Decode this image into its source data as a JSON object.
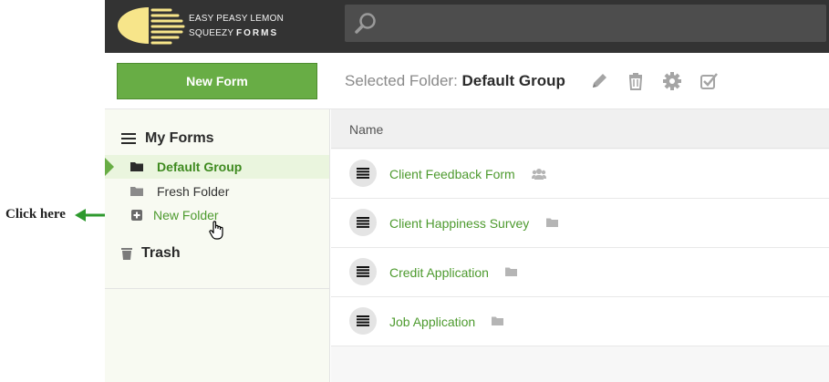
{
  "annotation": {
    "label": "Click here",
    "arrow_color": "#2e9a2e"
  },
  "header": {
    "logo_line1": "EASY PEASY LEMON",
    "logo_line2": "SQUEEZY",
    "logo_line2_bold": "FORMS",
    "search_icon": "search-icon",
    "logo_color": "#f7e58a"
  },
  "toolbar": {
    "new_form_label": "New Form",
    "selected_prefix": "Selected Folder: ",
    "selected_folder": "Default Group",
    "icons": [
      "pencil-icon",
      "trash-icon",
      "gear-icon",
      "checkbox-icon"
    ]
  },
  "sidebar": {
    "my_forms_label": "My Forms",
    "items": [
      {
        "label": "Default Group",
        "icon": "folder-icon",
        "active": true
      },
      {
        "label": "Fresh Folder",
        "icon": "folder-icon",
        "active": false
      },
      {
        "label": "New Folder",
        "icon": "plus-square-icon",
        "active": false
      }
    ],
    "trash_label": "Trash"
  },
  "table": {
    "column_name": "Name",
    "rows": [
      {
        "name": "Client Feedback Form",
        "tag_icon": "users-icon"
      },
      {
        "name": "Client Happiness Survey",
        "tag_icon": "folder-icon"
      },
      {
        "name": "Credit Application",
        "tag_icon": "folder-icon"
      },
      {
        "name": "Job Application",
        "tag_icon": "folder-icon"
      }
    ]
  },
  "colors": {
    "accent": "#68ad45",
    "link": "#4d9a2e",
    "topbar": "#333333"
  }
}
